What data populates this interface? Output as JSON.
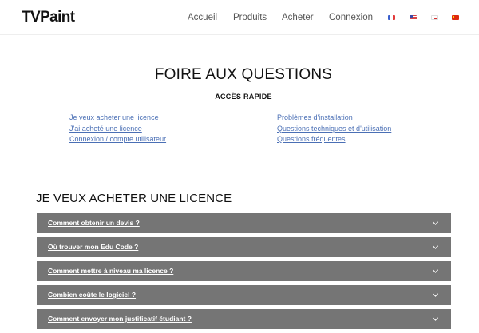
{
  "header": {
    "logo_text": "TVPaint",
    "nav": [
      "Accueil",
      "Produits",
      "Acheter",
      "Connexion"
    ],
    "flags": [
      "fr-flag-icon",
      "us-flag-icon",
      "jp-flag-icon",
      "cn-flag-icon"
    ]
  },
  "main": {
    "title": "FOIRE AUX QUESTIONS",
    "quick_title": "ACCÈS RAPIDE",
    "quick_links_left": [
      "Je veux acheter une licence",
      "J'ai acheté une licence",
      "Connexion / compte utilisateur"
    ],
    "quick_links_right": [
      "Problèmes d'installation",
      "Questions techniques et d'utilisation",
      "Questions fréquentes"
    ],
    "section_title": "JE VEUX ACHETER UNE LICENCE",
    "faq": [
      "Comment obtenir un devis ?",
      "Où trouver mon Edu Code ?",
      "Comment mettre à niveau ma licence ?",
      "Combien coûte le logiciel ?",
      "Comment envoyer mon justificatif étudiant ?"
    ]
  },
  "colors": {
    "accordion_bg": "#757575",
    "link": "#4a6fb5",
    "nav_text": "#555555"
  }
}
